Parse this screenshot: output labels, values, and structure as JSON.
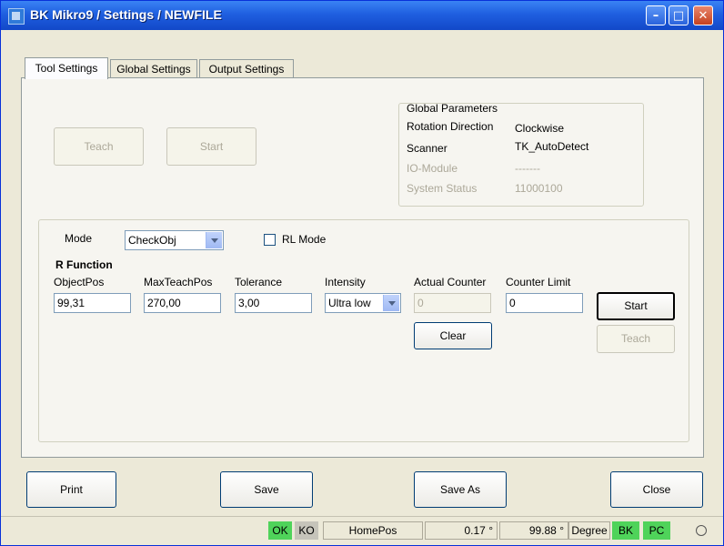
{
  "window": {
    "title": "BK Mikro9 / Settings / NEWFILE"
  },
  "tabs": [
    {
      "label": "Tool Settings",
      "active": true
    },
    {
      "label": "Global Settings",
      "active": false
    },
    {
      "label": "Output Settings",
      "active": false
    }
  ],
  "top_buttons": {
    "teach": "Teach",
    "start": "Start"
  },
  "global_params": {
    "title": "Global Parameters",
    "rows": [
      {
        "label": "Rotation Direction",
        "value": "Clockwise",
        "disabled": false
      },
      {
        "label": "Scanner",
        "value": "TK_AutoDetect",
        "disabled": false
      },
      {
        "label": "IO-Module",
        "value": "-------",
        "disabled": true
      },
      {
        "label": "System Status",
        "value": "11000100",
        "disabled": true
      }
    ]
  },
  "mode": {
    "label": "Mode",
    "value": "CheckObj",
    "rl_label": "RL Mode",
    "rl_checked": false
  },
  "r_function": {
    "title": "R Function",
    "object_pos": {
      "label": "ObjectPos",
      "value": "99,31"
    },
    "max_teach_pos": {
      "label": "MaxTeachPos",
      "value": "270,00"
    },
    "tolerance": {
      "label": "Tolerance",
      "value": "3,00"
    },
    "intensity": {
      "label": "Intensity",
      "value": "Ultra low"
    },
    "actual_counter": {
      "label": "Actual Counter",
      "value": "0"
    },
    "counter_limit": {
      "label": "Counter Limit",
      "value": "0"
    },
    "clear_label": "Clear",
    "start_label": "Start",
    "teach_label": "Teach"
  },
  "bottom_buttons": {
    "print": "Print",
    "save": "Save",
    "save_as": "Save As",
    "close": "Close"
  },
  "status_bar": {
    "ok": "OK",
    "ko": "KO",
    "home_pos": "HomePos",
    "pos_value": "0.17 °",
    "angle_value": "99.88 °",
    "unit": "Degree",
    "bk": "BK",
    "pc": "PC"
  },
  "colors": {
    "title_bar": "#1f5fe0",
    "status_green": "#4fd35a",
    "status_gray": "#c6c4ba",
    "face": "#ece9d8"
  }
}
